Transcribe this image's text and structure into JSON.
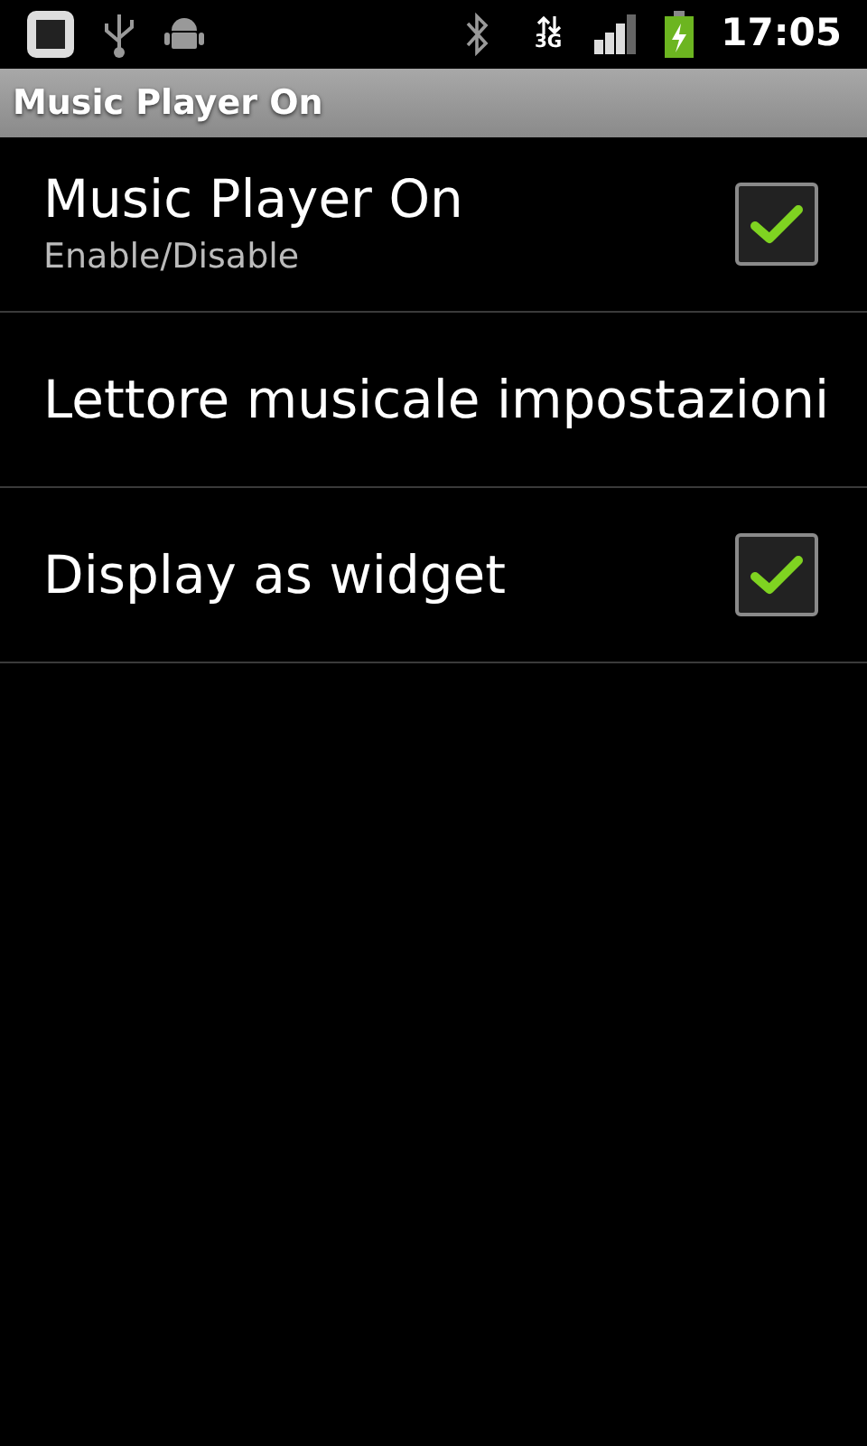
{
  "status_bar": {
    "network_label": "3G",
    "time": "17:05"
  },
  "title_bar": {
    "title": "Music Player On"
  },
  "preferences": [
    {
      "kind": "checkbox",
      "title": "Music Player On",
      "summary": "Enable/Disable",
      "checked": true
    },
    {
      "kind": "plain",
      "title": "Lettore musicale impostazioni"
    },
    {
      "kind": "checkbox",
      "title": "Display as widget",
      "checked": true
    }
  ]
}
